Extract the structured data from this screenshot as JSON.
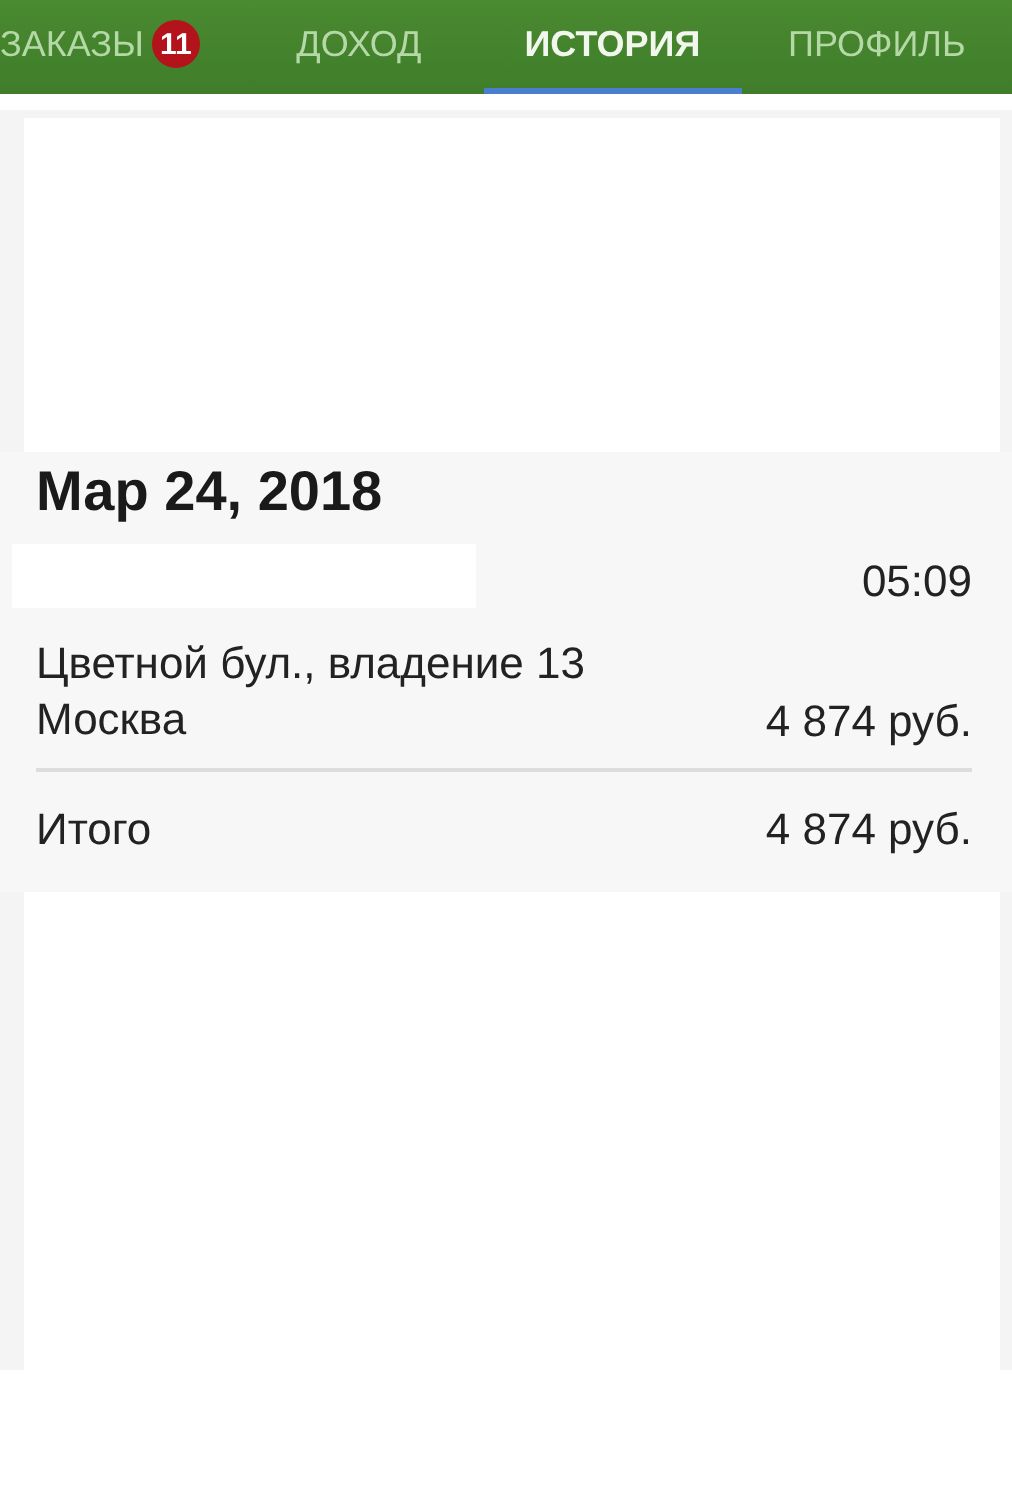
{
  "tabs": [
    {
      "label": "ЗАКАЗЫ",
      "badge": "11",
      "selected": false
    },
    {
      "label": "ДОХОД",
      "selected": false
    },
    {
      "label": "ИСТОРИЯ",
      "selected": true
    },
    {
      "label": "ПРОФИЛЬ",
      "selected": false
    }
  ],
  "history": {
    "date": "Мар 24, 2018",
    "time": "05:09",
    "address": "Цветной бул., владение 13",
    "city": "Москва",
    "amount": "4 874 руб.",
    "total_label": "Итого",
    "total": "4 874 руб."
  }
}
